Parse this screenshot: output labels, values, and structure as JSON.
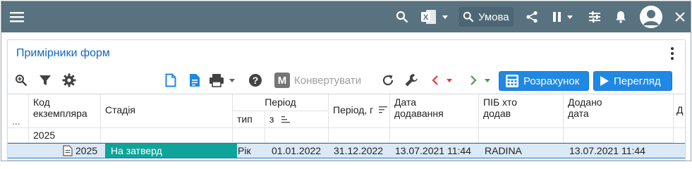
{
  "appbar": {
    "search_icon": "search-icon",
    "excel_icon": "excel-icon",
    "condition_label": "Умова",
    "share_icon": "share-icon",
    "pause_icon": "pause-icon",
    "settings_icon": "tune-icon",
    "bell_icon": "bell-icon",
    "avatar_icon": "account-icon",
    "close_icon": "close-icon",
    "bar_color": "#58727f"
  },
  "panel": {
    "title": "Примірники форм"
  },
  "toolbar": {
    "convert_label": "Конвертувати",
    "convert_icon_letter": "M",
    "calculate_label": "Розрахунок",
    "view_label": "Перегляд",
    "accent": "#1e88e5"
  },
  "grid": {
    "headers": {
      "dots": "...",
      "code_line1": "Код",
      "code_line2": "екземпляра",
      "stage": "Стадія",
      "period": "Період",
      "period_type": "тип",
      "period_from": "з",
      "period_to": "Період, г",
      "date_added_line1": "Дата",
      "date_added_line2": "додавання",
      "who_added_line1": "ПІБ хто",
      "who_added_line2": "додав",
      "added_line1": "Додано",
      "added_line2": "дата",
      "extra": "Д"
    },
    "group_label": "2025",
    "row": {
      "code": "2025",
      "stage": "На затверд",
      "period_type": "Рік",
      "from": "01.01.2022",
      "to": "31.12.2022",
      "date_added": "13.07.2021 11:44",
      "who": "RADINA",
      "added_date": "13.07.2021 11:44"
    },
    "stage_color": "#0fa39a"
  }
}
